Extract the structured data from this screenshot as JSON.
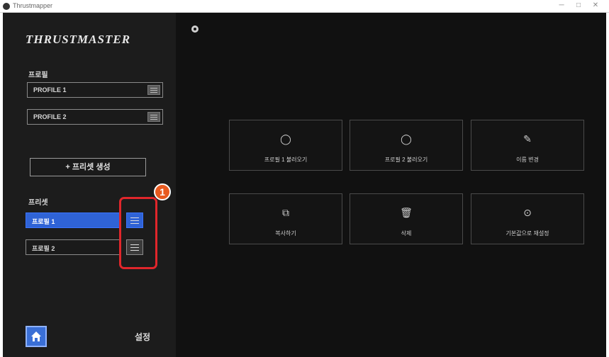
{
  "window": {
    "title": "Thrustmapper",
    "min": "─",
    "max": "□",
    "close": "✕"
  },
  "sidebar": {
    "logo": "THRUSTMASTER",
    "profiles_label": "프로필",
    "profiles": [
      {
        "name": "PROFILE 1"
      },
      {
        "name": "PROFILE 2"
      }
    ],
    "create_preset_label": "+ 프리셋 생성",
    "presets_label": "프리셋",
    "presets": [
      {
        "name": "프로필 1",
        "active": true
      },
      {
        "name": "프로필 2",
        "active": false
      }
    ],
    "settings_label": "설정"
  },
  "annotation": {
    "step": "1",
    "color": "#e0262b"
  },
  "actions": [
    {
      "icon": "circle-icon",
      "glyph": "◯",
      "label": "프로필 1 불러오기"
    },
    {
      "icon": "circle-icon",
      "glyph": "◯",
      "label": "프로필 2 불러오기"
    },
    {
      "icon": "pencil-icon",
      "glyph": "✎",
      "label": "이름 변경"
    },
    {
      "icon": "copy-icon",
      "glyph": "⧉",
      "label": "복사하기"
    },
    {
      "icon": "trash-icon",
      "glyph": "🗑",
      "label": "삭제"
    },
    {
      "icon": "reset-icon",
      "glyph": "⊙",
      "label": "기본값으로 재설정"
    }
  ],
  "colors": {
    "accent": "#2f63d6",
    "background": "#121212",
    "sidebar": "#1c1c1c"
  }
}
